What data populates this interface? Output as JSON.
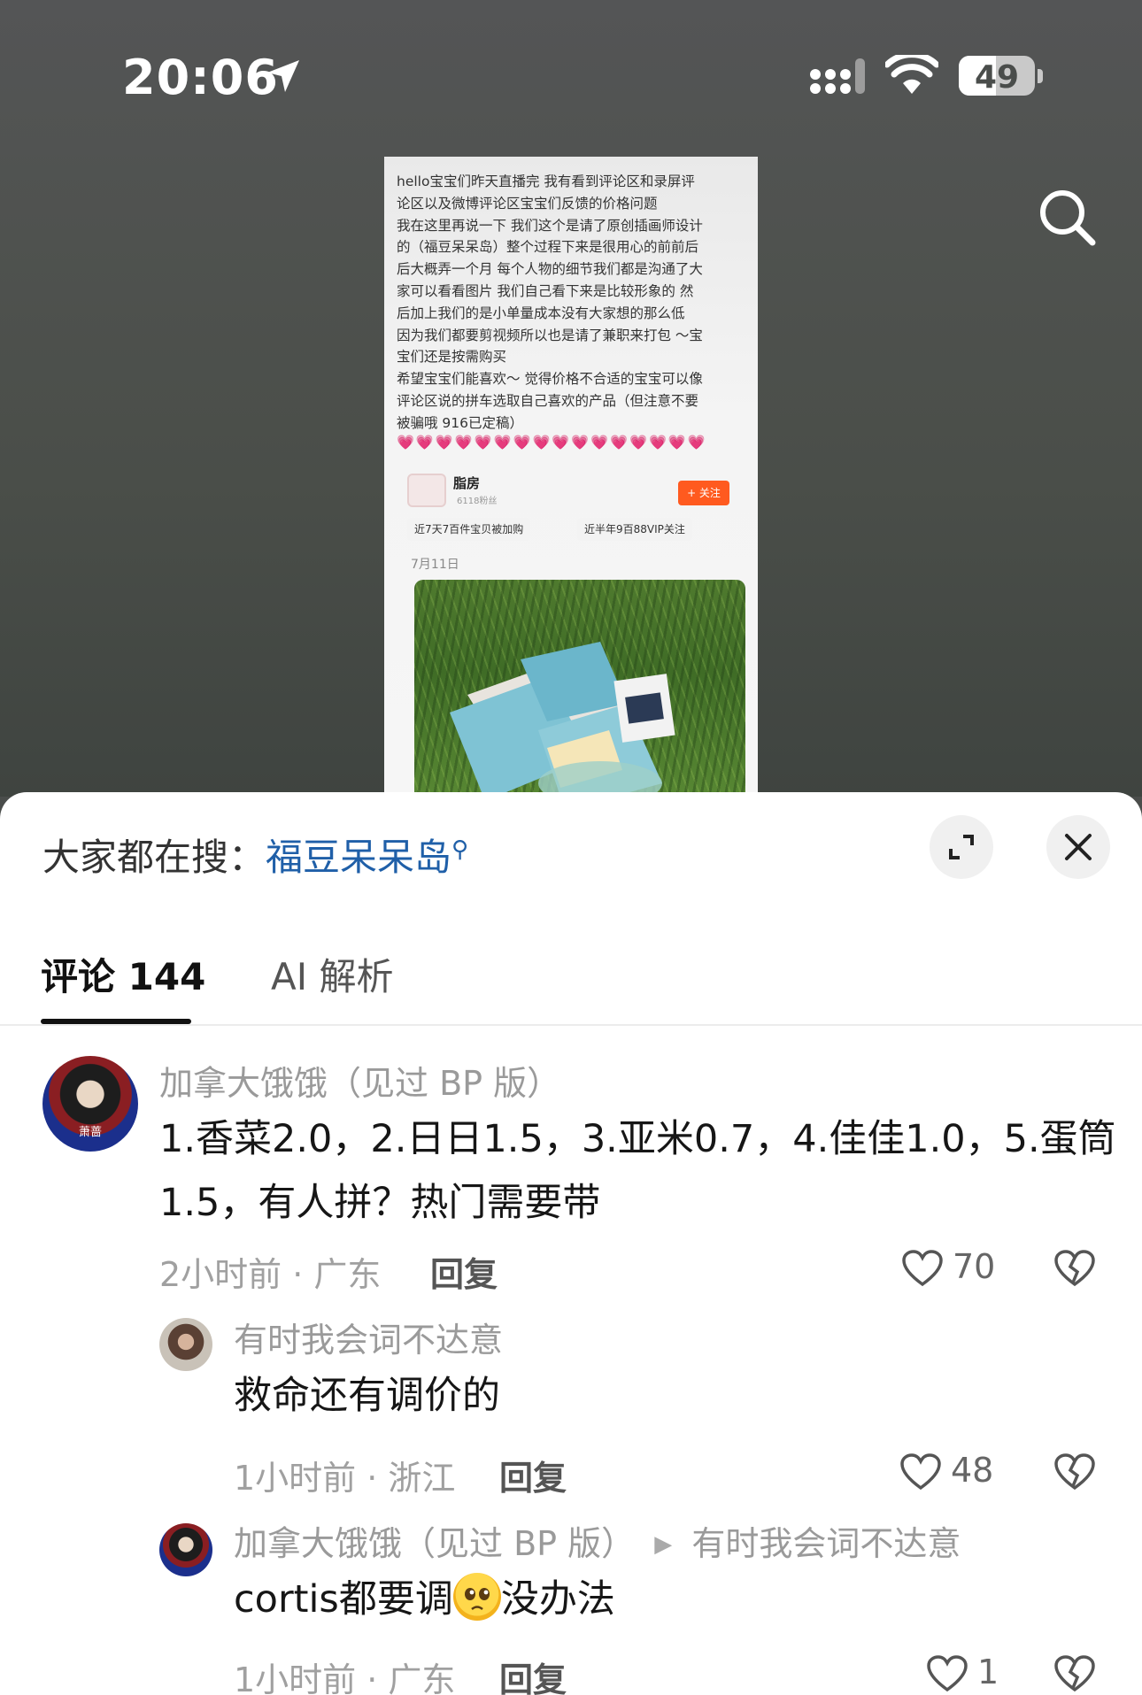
{
  "status_bar": {
    "time": "20:06",
    "battery": "49",
    "icons": [
      "location-arrow-icon",
      "signal-icon",
      "wifi-icon",
      "battery-icon"
    ]
  },
  "post": {
    "text": "hello宝宝们昨天直播完 我有看到评论区和录屏评\n论区以及微博评论区宝宝们反馈的价格问题\n我在这里再说一下 我们这个是请了原创插画师设计\n的（福豆呆呆岛）整个过程下来是很用心的前前后\n后大概弄一个月 每个人物的细节我们都是沟通了大\n家可以看看图片 我们自己看下来是比较形象的 然\n后加上我们的是小单量成本没有大家想的那么低\n因为我们都要剪视频所以也是请了兼职来打包 ～宝\n宝们还是按需购买\n希望宝宝们能喜欢～ 觉得价格不合适的宝宝可以像\n评论区说的拼车选取自己喜欢的产品（但注意不要\n被骗哦 916已定稿）",
    "hearts": "💗💗💗💗💗💗💗💗💗💗💗💗💗💗💗💗",
    "shop_name": "脂房",
    "shop_sub": "6118粉丝",
    "follow_label": "+ 关注",
    "tag_sales": "近7天7百件宝贝被加购",
    "tag_vip": "近半年9百88VIP关注",
    "date": "7月11日"
  },
  "sheet": {
    "trending_prefix": "大家都在搜：",
    "trending_keyword": "福豆呆呆岛",
    "tabs": [
      {
        "label": "评论 144"
      },
      {
        "label": "AI 解析"
      }
    ]
  },
  "comments": [
    {
      "user": "加拿大饿饿（见过 BP 版）",
      "avatar_label": "萧蔷",
      "line1": "1.香菜2.0，2.日日1.5，3.亚米0.7，4.佳佳1.0，5.蛋筒",
      "line2": "1.5，有人拼？热门需要带",
      "meta": "2小时前 · 广东",
      "reply": "回复",
      "likes": "70"
    },
    {
      "user": "有时我会词不达意",
      "text": "救命还有调价的",
      "meta": "1小时前 · 浙江",
      "reply": "回复",
      "likes": "48"
    },
    {
      "user": "加拿大饿饿（见过 BP 版）",
      "reply_to": "有时我会词不达意",
      "text_before": "cortis都要调",
      "text_after": "没办法",
      "emoji": "pleading-face-emoji",
      "meta": "1小时前 · 广东",
      "reply": "回复",
      "likes": "1"
    }
  ],
  "colors": {
    "keyword": "#1f5fa8",
    "follow": "#ff5a1f"
  }
}
